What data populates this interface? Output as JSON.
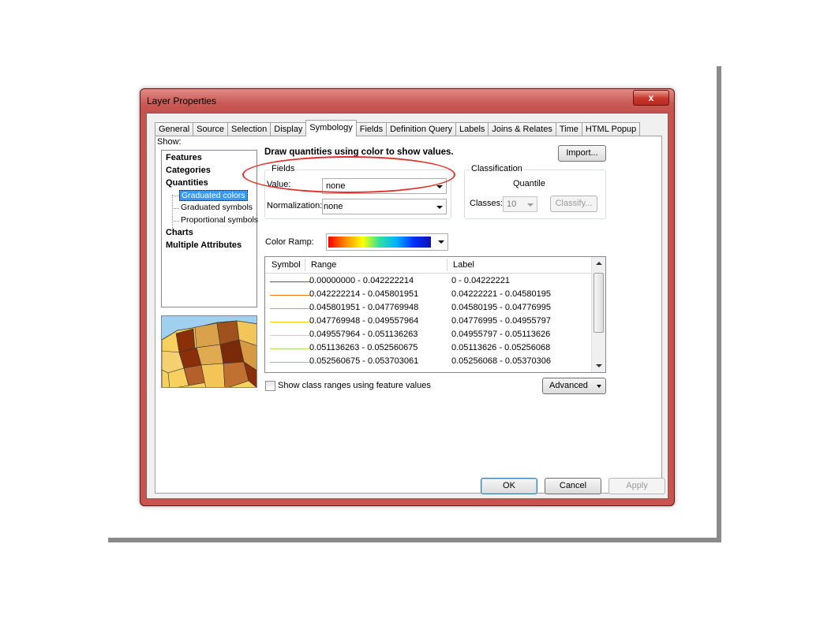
{
  "window": {
    "title": "Layer Properties",
    "close_glyph": "x"
  },
  "tabs": [
    "General",
    "Source",
    "Selection",
    "Display",
    "Symbology",
    "Fields",
    "Definition Query",
    "Labels",
    "Joins & Relates",
    "Time",
    "HTML Popup"
  ],
  "active_tab": "Symbology",
  "show": {
    "label": "Show:",
    "items": {
      "features": "Features",
      "categories": "Categories",
      "quantities": "Quantities",
      "graduated_colors": "Graduated colors",
      "graduated_symbols": "Graduated symbols",
      "proportional_symbols": "Proportional symbols",
      "charts": "Charts",
      "multiple_attributes": "Multiple Attributes"
    },
    "selected": "Graduated colors"
  },
  "symbology": {
    "heading": "Draw quantities using color to show values.",
    "import_label": "Import...",
    "fields": {
      "group_label": "Fields",
      "value_label": "Value:",
      "value": "none",
      "normalization_label": "Normalization:",
      "normalization": "none"
    },
    "classification": {
      "group_label": "Classification",
      "method": "Quantile",
      "classes_label": "Classes:",
      "classes": "10",
      "classify_label": "Classify..."
    },
    "color_ramp_label": "Color Ramp:",
    "table": {
      "headers": {
        "symbol": "Symbol",
        "range": "Range",
        "label": "Label"
      },
      "rows": [
        {
          "color": "#e8201a",
          "range": "0.00000000 - 0.042222214",
          "label": "0 - 0.04222221"
        },
        {
          "color": "#f07a10",
          "range": "0.042222214 - 0.045801951",
          "label": "0.04222221 - 0.04580195"
        },
        {
          "color": "#f0a010",
          "range": "0.045801951 - 0.047769948",
          "label": "0.04580195 - 0.04776995"
        },
        {
          "color": "#f0c810",
          "range": "0.047769948 - 0.049557964",
          "label": "0.04776995 - 0.04955797"
        },
        {
          "color": "#e0e820",
          "range": "0.049557964 - 0.051136263",
          "label": "0.04955797 - 0.05113626"
        },
        {
          "color": "#a8e860",
          "range": "0.051136263 - 0.052560675",
          "label": "0.05113626 - 0.05256068"
        },
        {
          "color": "#40e0c0",
          "range": "0.052560675 - 0.053703061",
          "label": "0.05256068 - 0.05370306"
        }
      ]
    },
    "show_class_ranges_label": "Show class ranges using feature values",
    "advanced_label": "Advanced"
  },
  "buttons": {
    "ok": "OK",
    "cancel": "Cancel",
    "apply": "Apply"
  }
}
